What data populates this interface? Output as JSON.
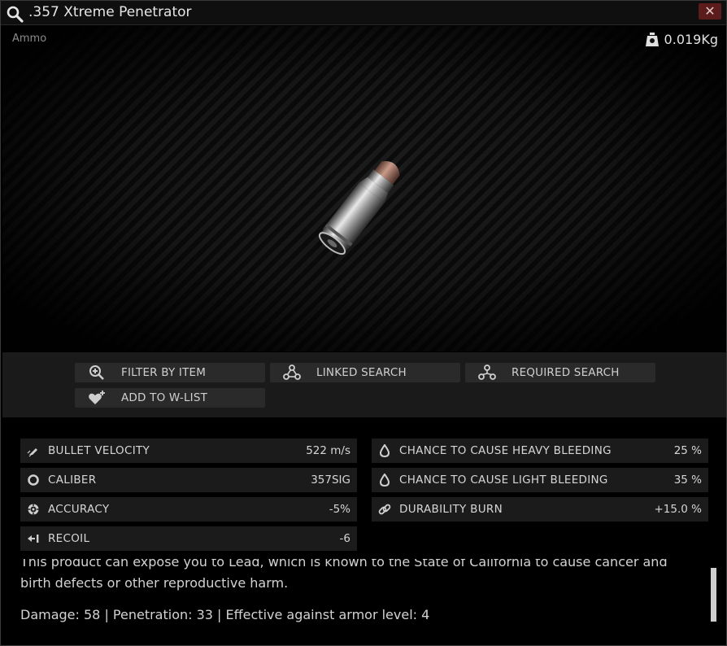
{
  "window": {
    "title": ".357 Xtreme Penetrator",
    "close_glyph": "✕"
  },
  "item": {
    "category": "Ammo",
    "weight": "0.019Kg"
  },
  "actions": [
    {
      "label": "FILTER BY ITEM",
      "icon": "magnify-plus-icon"
    },
    {
      "label": "LINKED SEARCH",
      "icon": "linked-nodes-icon"
    },
    {
      "label": "REQUIRED SEARCH",
      "icon": "required-nodes-icon"
    },
    {
      "label": "ADD TO W-LIST",
      "icon": "heart-plus-icon"
    }
  ],
  "stats_left": [
    {
      "name": "BULLET VELOCITY",
      "value": "522 m/s",
      "icon": "bullet-velocity-icon"
    },
    {
      "name": "CALIBER",
      "value": "357SIG",
      "icon": "caliber-ring-icon"
    },
    {
      "name": "ACCURACY",
      "value": "-5%",
      "icon": "crosshair-icon"
    },
    {
      "name": "RECOIL",
      "value": "-6",
      "icon": "recoil-icon"
    }
  ],
  "stats_right": [
    {
      "name": "CHANCE TO CAUSE HEAVY BLEEDING",
      "value": "25 %",
      "icon": "blood-drop-icon"
    },
    {
      "name": "CHANCE TO CAUSE LIGHT BLEEDING",
      "value": "35 %",
      "icon": "blood-drop-icon"
    },
    {
      "name": "DURABILITY BURN",
      "value": "+15.0 %",
      "icon": "chain-link-icon"
    }
  ],
  "description": {
    "line1": "This product can expose you to Lead, which is known to the State of California to cause cancer and",
    "line2": "birth defects or other reproductive harm.",
    "line3": "Damage: 58 | Penetration: 33 | Effective against armor level: 4"
  },
  "colors": {
    "close_bg": "#5c1c1c",
    "stat_bg": "#1b1b1b",
    "button_bg": "#2a2a2a"
  }
}
